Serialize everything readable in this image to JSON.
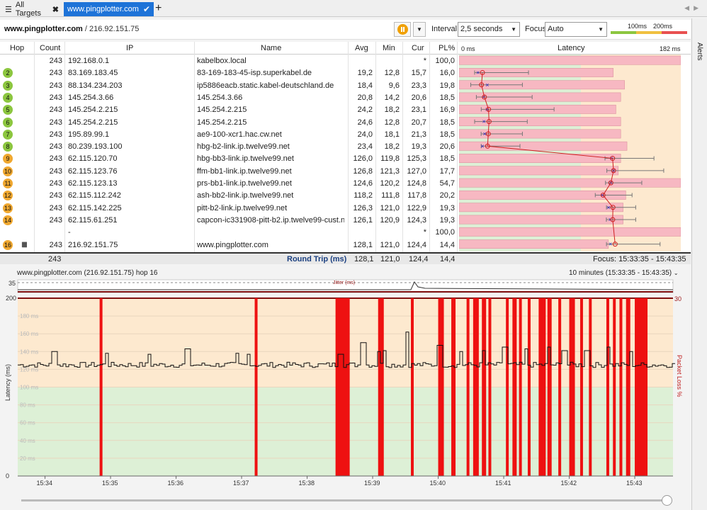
{
  "tabs": {
    "menu_icon": "hamburger-icon",
    "all_label": "All Targets",
    "active_label": "www.pingplotter.com",
    "add": "+"
  },
  "toolbar": {
    "host": "www.pingplotter.com",
    "ip": "/ 216.92.151.75",
    "interval_label": "Interval",
    "interval_value": "2,5 seconds",
    "focus_label": "Focus",
    "focus_value": "Auto",
    "scale_100": "100ms",
    "scale_200": "200ms"
  },
  "alerts_label": "Alerts",
  "columns": {
    "hop": "Hop",
    "count": "Count",
    "ip": "IP",
    "name": "Name",
    "avg": "Avg",
    "min": "Min",
    "cur": "Cur",
    "pl": "PL%",
    "lat_start": "0 ms",
    "latency": "Latency",
    "lat_end": "182 ms"
  },
  "hops": [
    {
      "hop": "",
      "count": "243",
      "ip": "192.168.0.1",
      "name": "kabelbox.local",
      "avg": "",
      "min": "",
      "cur": "*",
      "pl": "100,0",
      "color": "",
      "avgv": null,
      "minv": null,
      "maxv": null,
      "curv": null,
      "loss": 100
    },
    {
      "hop": "2",
      "count": "243",
      "ip": "83.169.183.45",
      "name": "83-169-183-45-isp.superkabel.de",
      "avg": "19,2",
      "min": "12,8",
      "cur": "15,7",
      "pl": "16,0",
      "color": "#8cc63f",
      "avgv": 19.2,
      "minv": 12.8,
      "maxv": 57,
      "curv": 15.7,
      "loss": 16.0
    },
    {
      "hop": "3",
      "count": "243",
      "ip": "88.134.234.203",
      "name": "ip5886eacb.static.kabel-deutschland.de",
      "avg": "18,4",
      "min": "9,6",
      "cur": "23,3",
      "pl": "19,8",
      "color": "#8cc63f",
      "avgv": 18.4,
      "minv": 9.6,
      "maxv": 52,
      "curv": 23.3,
      "loss": 19.8
    },
    {
      "hop": "4",
      "count": "243",
      "ip": "145.254.3.66",
      "name": "145.254.3.66",
      "avg": "20,8",
      "min": "14,2",
      "cur": "20,6",
      "pl": "18,5",
      "color": "#8cc63f",
      "avgv": 20.8,
      "minv": 14.2,
      "maxv": 60,
      "curv": 20.6,
      "loss": 18.5
    },
    {
      "hop": "5",
      "count": "243",
      "ip": "145.254.2.215",
      "name": "145.254.2.215",
      "avg": "24,2",
      "min": "18,2",
      "cur": "23,1",
      "pl": "16,9",
      "color": "#8cc63f",
      "avgv": 24.2,
      "minv": 18.2,
      "maxv": 78,
      "curv": 23.1,
      "loss": 16.9
    },
    {
      "hop": "6",
      "count": "243",
      "ip": "145.254.2.215",
      "name": "145.254.2.215",
      "avg": "24,6",
      "min": "12,8",
      "cur": "20,7",
      "pl": "18,5",
      "color": "#8cc63f",
      "avgv": 24.6,
      "minv": 12.8,
      "maxv": 56,
      "curv": 20.7,
      "loss": 18.5
    },
    {
      "hop": "7",
      "count": "243",
      "ip": "195.89.99.1",
      "name": "ae9-100-xcr1.hac.cw.net",
      "avg": "24,0",
      "min": "18,1",
      "cur": "21,3",
      "pl": "18,5",
      "color": "#8cc63f",
      "avgv": 24.0,
      "minv": 18.1,
      "maxv": 52,
      "curv": 21.3,
      "loss": 18.5
    },
    {
      "hop": "8",
      "count": "243",
      "ip": "80.239.193.100",
      "name": "hbg-b2-link.ip.twelve99.net",
      "avg": "23,4",
      "min": "18,2",
      "cur": "19,3",
      "pl": "20,6",
      "color": "#8cc63f",
      "avgv": 23.4,
      "minv": 18.2,
      "maxv": 50,
      "curv": 19.3,
      "loss": 20.6
    },
    {
      "hop": "9",
      "count": "243",
      "ip": "62.115.120.70",
      "name": "hbg-bb3-link.ip.twelve99.net",
      "avg": "126,0",
      "min": "119,8",
      "cur": "125,3",
      "pl": "18,5",
      "color": "#f0a830",
      "avgv": 126.0,
      "minv": 119.8,
      "maxv": 160,
      "curv": 125.3,
      "loss": 18.5
    },
    {
      "hop": "10",
      "count": "243",
      "ip": "62.115.123.76",
      "name": "ffm-bb1-link.ip.twelve99.net",
      "avg": "126,8",
      "min": "121,3",
      "cur": "127,0",
      "pl": "17,7",
      "color": "#f0a830",
      "avgv": 126.8,
      "minv": 121.3,
      "maxv": 168,
      "curv": 127.0,
      "loss": 17.7
    },
    {
      "hop": "11",
      "count": "243",
      "ip": "62.115.123.13",
      "name": "prs-bb1-link.ip.twelve99.net",
      "avg": "124,6",
      "min": "120,2",
      "cur": "124,8",
      "pl": "54,7",
      "color": "#f0a830",
      "avgv": 124.6,
      "minv": 120.2,
      "maxv": 150,
      "curv": 124.8,
      "loss": 54.7
    },
    {
      "hop": "12",
      "count": "243",
      "ip": "62.115.112.242",
      "name": "ash-bb2-link.ip.twelve99.net",
      "avg": "118,2",
      "min": "111,8",
      "cur": "117,8",
      "pl": "20,2",
      "color": "#f0a830",
      "avgv": 118.2,
      "minv": 111.8,
      "maxv": 142,
      "curv": 117.8,
      "loss": 20.2
    },
    {
      "hop": "13",
      "count": "243",
      "ip": "62.115.142.225",
      "name": "pitt-b2-link.ip.twelve99.net",
      "avg": "126,3",
      "min": "121,0",
      "cur": "122,9",
      "pl": "19,3",
      "color": "#f0a830",
      "avgv": 126.3,
      "minv": 121.0,
      "maxv": 145,
      "curv": 122.9,
      "loss": 19.3
    },
    {
      "hop": "14",
      "count": "243",
      "ip": "62.115.61.251",
      "name": "capcon-ic331908-pitt-b2.ip.twelve99-cust.net",
      "avg": "126,1",
      "min": "120,9",
      "cur": "124,3",
      "pl": "19,3",
      "color": "#f0a830",
      "avgv": 126.1,
      "minv": 120.9,
      "maxv": 145,
      "curv": 124.3,
      "loss": 19.3
    },
    {
      "hop": "",
      "count": "",
      "ip": "-",
      "name": "",
      "avg": "",
      "min": "",
      "cur": "*",
      "pl": "100,0",
      "color": "",
      "avgv": null,
      "minv": null,
      "maxv": null,
      "curv": null,
      "loss": 100
    },
    {
      "hop": "16",
      "count": "243",
      "ip": "216.92.151.75",
      "name": "www.pingplotter.com",
      "avg": "128,1",
      "min": "121,0",
      "cur": "124,4",
      "pl": "14,4",
      "color": "#f0a830",
      "avgv": 128.1,
      "minv": 121.0,
      "maxv": 165,
      "curv": 124.4,
      "loss": 14.4
    }
  ],
  "summary": {
    "count": "243",
    "label": "Round Trip (ms)",
    "avg": "128,1",
    "min": "121,0",
    "cur": "124,4",
    "pl": "14,4",
    "focus": "Focus: 15:33:35 - 15:43:35"
  },
  "chart_data": {
    "type": "line",
    "title": "www.pingplotter.com (216.92.151.75) hop 16",
    "range": "10 minutes (15:33:35 - 15:43:35)",
    "jitter_label": "Jitter (ms)",
    "jitter_max": "35",
    "ylabel": "Latency (ms)",
    "ylabel_right": "Packet Loss %",
    "ylim": [
      0,
      200
    ],
    "y_right_max": "30",
    "y_ticks": [
      "200",
      "180 ms",
      "160 ms",
      "140 ms",
      "120 ms",
      "100 ms",
      "80 ms",
      "60 ms",
      "40 ms",
      "20 ms",
      "0"
    ],
    "x_ticks": [
      "15:34",
      "15:35",
      "15:36",
      "15:37",
      "15:38",
      "15:39",
      "15:40",
      "15:41",
      "15:42",
      "15:43"
    ],
    "baseline_ms": 125,
    "loss_bars": [
      {
        "t": "15:34:50",
        "w": 4
      },
      {
        "t": "15:37:12",
        "w": 4
      },
      {
        "t": "15:38:26",
        "w": 20
      },
      {
        "t": "15:39:05",
        "w": 8
      },
      {
        "t": "15:39:35",
        "w": 4
      },
      {
        "t": "15:40:00",
        "w": 8
      },
      {
        "t": "15:40:12",
        "w": 6
      },
      {
        "t": "15:40:26",
        "w": 4
      },
      {
        "t": "15:40:32",
        "w": 8
      },
      {
        "t": "15:40:40",
        "w": 6
      },
      {
        "t": "15:40:46",
        "w": 4
      },
      {
        "t": "15:41:02",
        "w": 4
      },
      {
        "t": "15:41:08",
        "w": 6
      },
      {
        "t": "15:41:14",
        "w": 4
      },
      {
        "t": "15:41:22",
        "w": 4
      },
      {
        "t": "15:41:32",
        "w": 10
      },
      {
        "t": "15:41:40",
        "w": 6
      },
      {
        "t": "15:41:50",
        "w": 4
      },
      {
        "t": "15:42:00",
        "w": 8
      },
      {
        "t": "15:42:10",
        "w": 4
      },
      {
        "t": "15:42:18",
        "w": 4
      },
      {
        "t": "15:42:34",
        "w": 4
      },
      {
        "t": "15:42:40",
        "w": 4
      },
      {
        "t": "15:42:46",
        "w": 4
      },
      {
        "t": "15:42:52",
        "w": 6
      },
      {
        "t": "15:43:00",
        "w": 18
      }
    ],
    "spikes": [
      {
        "t": "15:34:08",
        "ms": 140
      },
      {
        "t": "15:34:55",
        "ms": 138
      },
      {
        "t": "15:35:35",
        "ms": 137
      },
      {
        "t": "15:36:10",
        "ms": 143
      },
      {
        "t": "15:36:55",
        "ms": 138
      },
      {
        "t": "15:37:05",
        "ms": 137
      },
      {
        "t": "15:38:30",
        "ms": 137
      },
      {
        "t": "15:38:50",
        "ms": 150
      },
      {
        "t": "15:39:05",
        "ms": 140
      },
      {
        "t": "15:39:10",
        "ms": 141
      },
      {
        "t": "15:39:30",
        "ms": 162
      },
      {
        "t": "15:40:00",
        "ms": 147
      },
      {
        "t": "15:40:20",
        "ms": 140
      },
      {
        "t": "15:40:40",
        "ms": 141
      },
      {
        "t": "15:41:00",
        "ms": 145
      },
      {
        "t": "15:41:20",
        "ms": 143
      },
      {
        "t": "15:41:40",
        "ms": 145
      },
      {
        "t": "15:41:55",
        "ms": 141
      },
      {
        "t": "15:42:15",
        "ms": 141
      },
      {
        "t": "15:42:35",
        "ms": 145
      },
      {
        "t": "15:42:55",
        "ms": 140
      }
    ]
  }
}
